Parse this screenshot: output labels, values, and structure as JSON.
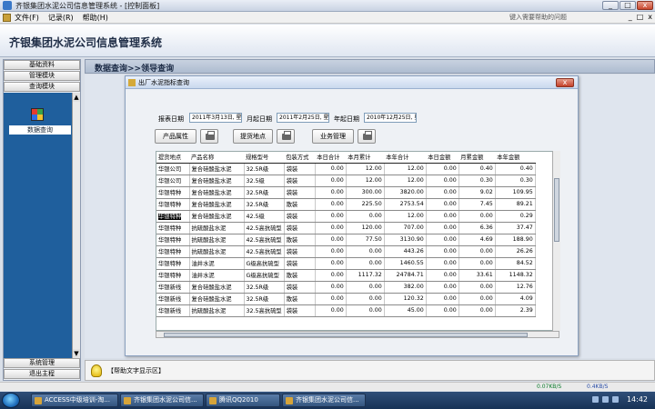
{
  "window": {
    "title": "齐银集团水泥公司信息管理系统 - [控制面板]",
    "min": "_",
    "max": "□",
    "close": "x"
  },
  "menu": {
    "items": [
      "文件(F)",
      "记录(R)",
      "帮助(H)"
    ],
    "help_placeholder": "键入需要帮助的问题",
    "sub_min": "_",
    "sub_max": "□",
    "sub_close": "x"
  },
  "banner": {
    "title": "齐银集团水泥公司信息管理系统"
  },
  "sidebar": {
    "items": [
      "基础资料",
      "管理模块",
      "查询模块"
    ],
    "module_label": "数据查询",
    "bottom_items": [
      "系统管理",
      "退出主程"
    ],
    "scroll_up": "▲",
    "scroll_down": "▼"
  },
  "main": {
    "header": "数据查询>>领导查询",
    "help_text": "【帮助文字显示区】"
  },
  "dialog": {
    "title": "出厂水泥指标查询",
    "close": "x",
    "date_labels": [
      "报表日期",
      "月起日期",
      "年起日期"
    ],
    "date_values": [
      "2011年3月13日, 星",
      "2011年2月25日, 星",
      "2010年12月25日, 星"
    ],
    "buttons": [
      "产品属性",
      "提货地点",
      "业务管理"
    ],
    "table": {
      "headers": [
        "提货地点",
        "产品名称",
        "规格型号",
        "包装方式",
        "本日合计",
        "本月累计",
        "本年合计",
        "本日金额",
        "月累金额",
        "本年金额"
      ],
      "rows": [
        [
          "华银公司",
          "复合硅酸盐水泥",
          "32.5R级",
          "袋装",
          "0.00",
          "12.00",
          "12.00",
          "0.00",
          "0.40",
          "0.40"
        ],
        [
          "华银公司",
          "复合硅酸盐水泥",
          "32.5级",
          "袋装",
          "0.00",
          "12.00",
          "12.00",
          "0.00",
          "0.30",
          "0.30"
        ],
        [
          "华银特种",
          "复合硅酸盐水泥",
          "32.5R级",
          "袋装",
          "0.00",
          "300.00",
          "3820.00",
          "0.00",
          "9.02",
          "109.95"
        ],
        [
          "华银特种",
          "复合硅酸盐水泥",
          "32.5R级",
          "散装",
          "0.00",
          "225.50",
          "2753.54",
          "0.00",
          "7.45",
          "89.21"
        ],
        [
          "华银特种",
          "复合硅酸盐水泥",
          "42.5级",
          "袋装",
          "0.00",
          "0.00",
          "12.00",
          "0.00",
          "0.00",
          "0.29"
        ],
        [
          "华银特种",
          "抗硫酸盐水泥",
          "42.5高抗硫型",
          "袋装",
          "0.00",
          "120.00",
          "707.00",
          "0.00",
          "6.36",
          "37.47"
        ],
        [
          "华银特种",
          "抗硫酸盐水泥",
          "42.5高抗硫型",
          "散装",
          "0.00",
          "77.50",
          "3130.90",
          "0.00",
          "4.69",
          "188.90"
        ],
        [
          "华银特种",
          "抗硫酸盐水泥",
          "42.5高抗硫型",
          "袋装",
          "0.00",
          "0.00",
          "443.26",
          "0.00",
          "0.00",
          "26.26"
        ],
        [
          "华银特种",
          "油井水泥",
          "G级高抗硫型",
          "袋装",
          "0.00",
          "0.00",
          "1460.55",
          "0.00",
          "0.00",
          "84.52"
        ],
        [
          "华银特种",
          "油井水泥",
          "G级高抗硫型",
          "散装",
          "0.00",
          "1117.32",
          "24784.71",
          "0.00",
          "33.61",
          "1148.32"
        ],
        [
          "华银新线",
          "复合硅酸盐水泥",
          "32.5R级",
          "袋装",
          "0.00",
          "0.00",
          "382.00",
          "0.00",
          "0.00",
          "12.76"
        ],
        [
          "华银新线",
          "复合硅酸盐水泥",
          "32.5R级",
          "散装",
          "0.00",
          "0.00",
          "120.32",
          "0.00",
          "0.00",
          "4.09"
        ],
        [
          "华银新线",
          "抗硫酸盐水泥",
          "32.5高抗硫型",
          "袋装",
          "0.00",
          "0.00",
          "45.00",
          "0.00",
          "0.00",
          "2.39"
        ]
      ]
    }
  },
  "status": {
    "down": "0.07KB/S",
    "up": "0.4KB/S"
  },
  "taskbar": {
    "items": [
      "ACCESS中级培训-淘...",
      "齐银集团水泥公司信...",
      "腾讯QQ2010",
      "齐银集团水泥公司信..."
    ],
    "clock": "14:42"
  }
}
